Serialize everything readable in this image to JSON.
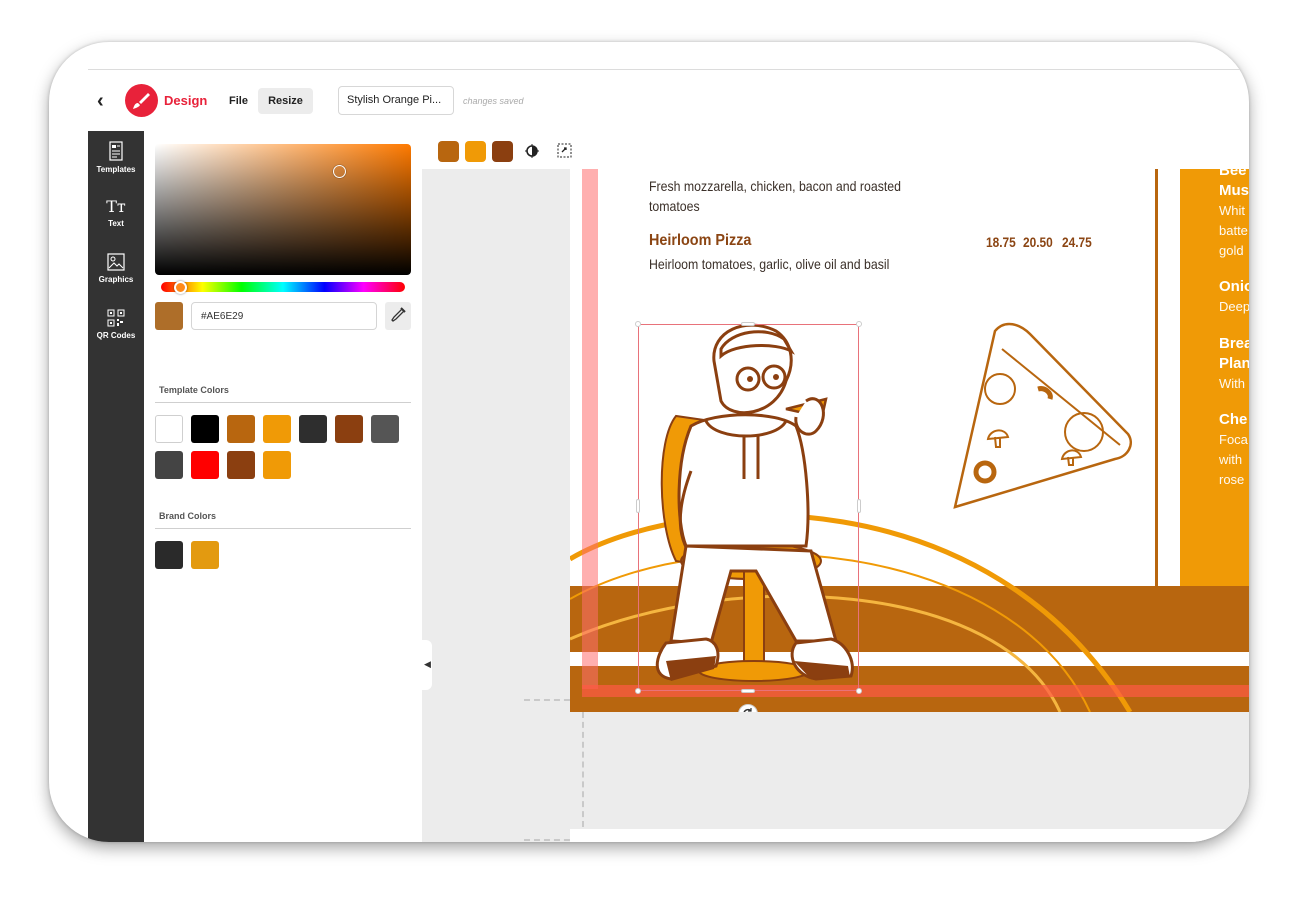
{
  "header": {
    "back_icon": "chevron-left-icon",
    "logo_icon": "brush-icon",
    "app_label": "Design",
    "menu_file": "File",
    "menu_resize": "Resize",
    "document_name": "Stylish Orange Pi...",
    "save_status": "changes saved"
  },
  "sidebar": {
    "items": [
      {
        "label": "Templates",
        "icon": "templates-icon"
      },
      {
        "label": "Text",
        "icon": "text-icon"
      },
      {
        "label": "Graphics",
        "icon": "graphics-icon"
      },
      {
        "label": "QR Codes",
        "icon": "qr-code-icon"
      }
    ]
  },
  "color_panel": {
    "current_color": "#AE6E29",
    "hex_value": "#AE6E29",
    "picker_hue": "#ff7a00",
    "eyedropper_icon": "eyedropper-icon",
    "template_colors_title": "Template Colors",
    "template_colors": [
      "#ffffff",
      "#000000",
      "#b8660f",
      "#f09a06",
      "#2e2e2e",
      "#8b3f10",
      "#555555",
      "#444444",
      "#ff0000",
      "#8b3f10",
      "#f09a06"
    ],
    "brand_colors_title": "Brand Colors",
    "brand_colors": [
      "#2a2a2a",
      "#e39a10"
    ]
  },
  "toolbar": {
    "swatches": [
      "#b8660f",
      "#f09a06",
      "#8b3f10"
    ],
    "contrast_icon": "contrast-icon",
    "replace_icon": "replace-color-icon"
  },
  "menu": {
    "item1_desc_line1": "Fresh mozzarella, chicken, bacon and roasted",
    "item1_desc_line2": "tomatoes",
    "item2_title": "Heirloom Pizza",
    "item2_prices": [
      "18.75",
      "20.50",
      "24.75"
    ],
    "item2_desc": "Heirloom tomatoes, garlic, olive oil and basil",
    "side_items": [
      {
        "title_lines": [
          "Bee",
          "Mus"
        ],
        "desc_lines": [
          "Whit",
          "batte",
          "gold"
        ]
      },
      {
        "title_lines": [
          "Onio"
        ],
        "desc_lines": [
          "Deep"
        ]
      },
      {
        "title_lines": [
          "Brea",
          "Plan"
        ],
        "desc_lines": [
          "With"
        ]
      },
      {
        "title_lines": [
          "Che"
        ],
        "desc_lines": [
          "Foca",
          "with",
          "rose"
        ]
      }
    ],
    "rotate_icon": "rotate-icon",
    "colors": {
      "orange": "#f09a06",
      "brown": "#b8660f",
      "dark_brown": "#7a3a12"
    }
  }
}
